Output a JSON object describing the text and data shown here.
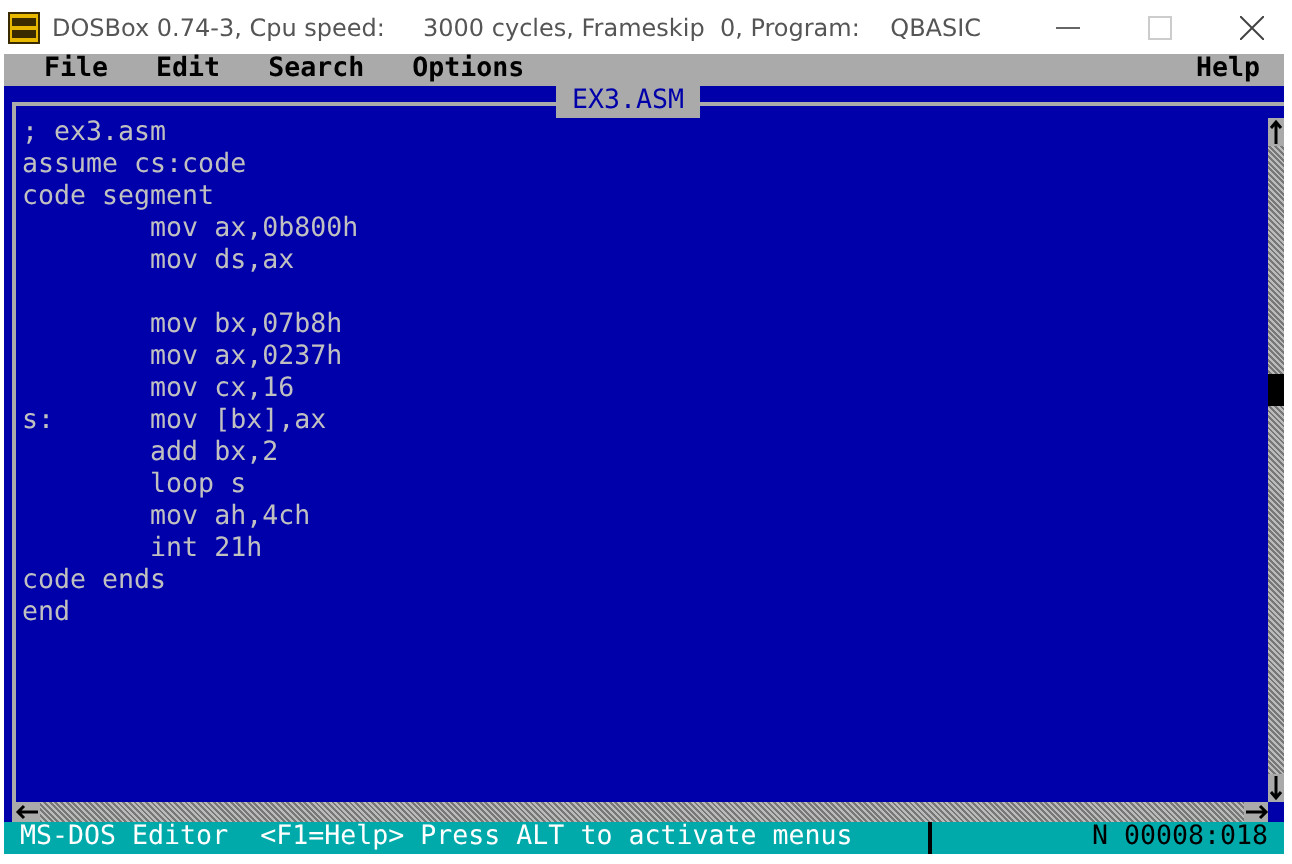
{
  "window": {
    "title": "DOSBox 0.74-3, Cpu speed:     3000 cycles, Frameskip  0, Program:    QBASIC"
  },
  "menu": [
    {
      "label": "File"
    },
    {
      "label": "Edit"
    },
    {
      "label": "Search"
    },
    {
      "label": "Options"
    }
  ],
  "help_menu": {
    "label": "Help"
  },
  "editor": {
    "title": "EX3.ASM",
    "blocks": [
      [
        "; ex3.asm",
        "assume cs:code",
        "code segment",
        "        mov ax,0b800h",
        "        mov ds,ax"
      ],
      [
        "        mov bx,07b8h",
        "        mov ax,0237h",
        "        mov cx,16",
        "s:      mov [bx],ax",
        "        add bx,2",
        "        loop s",
        "        mov ah,4ch",
        "        int 21h",
        "code ends",
        "end"
      ]
    ]
  },
  "status_bar": {
    "message": "MS-DOS Editor  <F1=Help> Press ALT to activate menus",
    "position": "N 00008:018"
  }
}
